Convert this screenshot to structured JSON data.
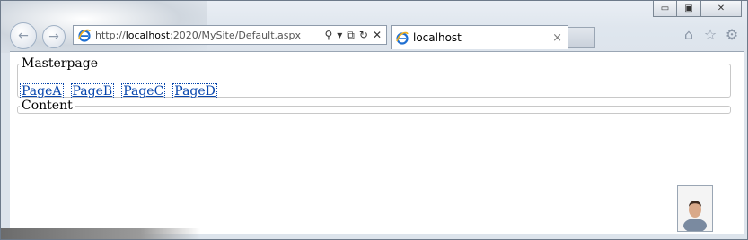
{
  "browser": {
    "address": {
      "url_prefix": "http://",
      "url_host": "localhost",
      "url_rest": ":2020/MySite/Default.aspx",
      "icon": "ie-icon"
    },
    "tab": {
      "title": "localhost",
      "close_glyph": "×",
      "icon": "ie-icon"
    },
    "window_controls": {
      "minimize": "▭",
      "maximize": "▣",
      "close": "✕"
    },
    "nav": {
      "back": "←",
      "forward": "→"
    },
    "address_icons": {
      "search": "⚲",
      "dropdown": "▾",
      "compat": "⧉",
      "refresh": "↻",
      "stop": "✕"
    },
    "tools": {
      "home": "⌂",
      "favorites": "☆",
      "settings": "⚙"
    }
  },
  "page": {
    "master_legend": "Masterpage",
    "links": [
      "PageA",
      "PageB",
      "PageC",
      "PageD"
    ],
    "content_legend": "Content"
  },
  "colors": {
    "link": "#0645ad",
    "ie_blue": "#1f6fd1",
    "ie_gold": "#f2b01e"
  }
}
